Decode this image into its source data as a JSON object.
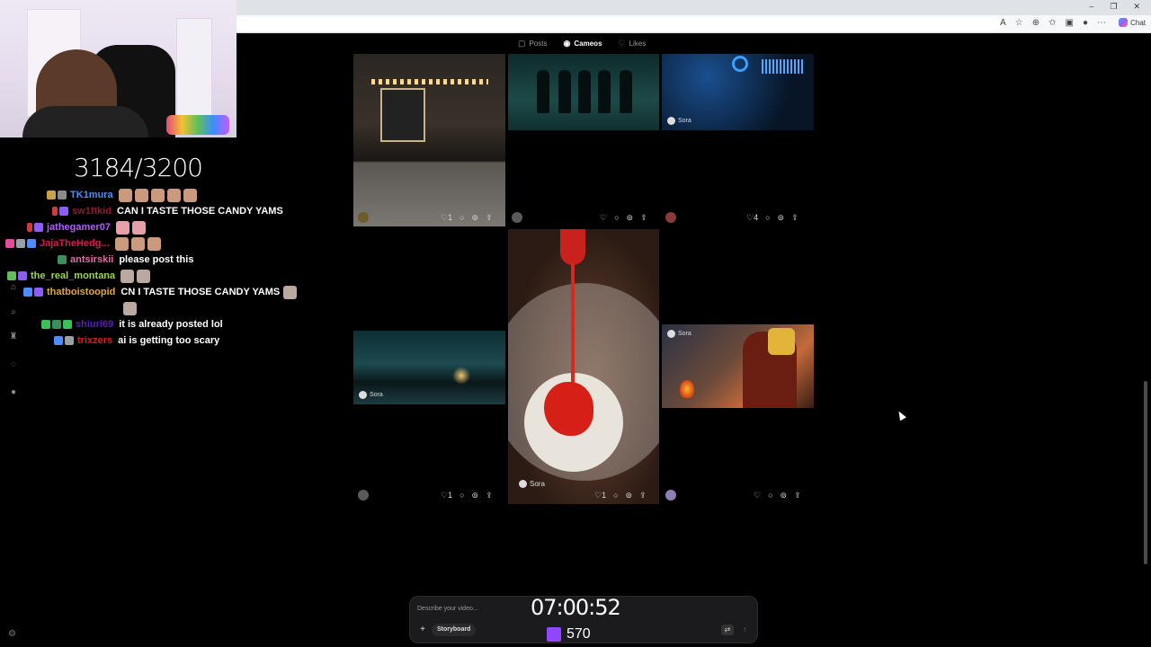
{
  "window": {
    "minimize": "–",
    "restore": "❐",
    "close": "✕"
  },
  "browser": {
    "copilot_label": "Chat"
  },
  "stream": {
    "counter": "3184/3200",
    "timer": "07:00:52",
    "viewers": "570"
  },
  "chat": {
    "messages": [
      {
        "user": "TK1mura",
        "color": "#4d8dff",
        "text": ""
      },
      {
        "user": "sw1ftkid",
        "color": "#8a1d2c",
        "text": "CAN I TASTE THOSE CANDY YAMS"
      },
      {
        "user": "jathegamer07",
        "color": "#b05cff",
        "text": ""
      },
      {
        "user": "JajaTheHedg...",
        "color": "#e0194d",
        "text": ""
      },
      {
        "user": "antsirskii",
        "color": "#e86aa8",
        "text": "please post this"
      },
      {
        "user": "the_real_montana",
        "color": "#9bd35a",
        "text": ""
      },
      {
        "user": "thatboistoopid",
        "color": "#e3a63a",
        "text": "CN I TASTE THOSE CANDY YAMS"
      },
      {
        "user": "shiuri69",
        "color": "#5a1fb5",
        "text": "it is already posted lol"
      },
      {
        "user": "trixzers",
        "color": "#e01a1a",
        "text": "ai is getting too scary"
      }
    ]
  },
  "tabs": [
    {
      "label": "Posts",
      "icon": "posts-icon"
    },
    {
      "label": "Cameos",
      "icon": "cameo-icon"
    },
    {
      "label": "Likes",
      "icon": "heart-icon"
    }
  ],
  "watermark": {
    "brand": "Sora"
  },
  "posts": [
    {
      "likes": "1"
    },
    {
      "likes": ""
    },
    {
      "likes": "4"
    },
    {
      "likes": "1"
    },
    {
      "likes": "1"
    },
    {
      "likes": ""
    }
  ],
  "composer": {
    "placeholder": "Describe your video...",
    "storyboard_label": "Storyboard"
  },
  "colors": {
    "background": "#000000",
    "accent": "#9146ff"
  }
}
